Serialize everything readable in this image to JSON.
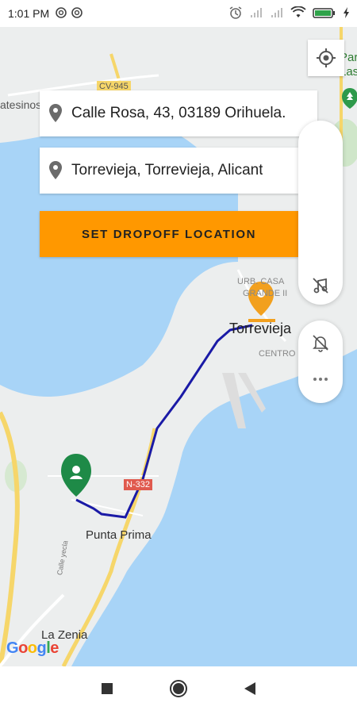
{
  "status_bar": {
    "time": "1:01 PM"
  },
  "search": {
    "pickup_text": "Calle Rosa, 43, 03189 Orihuela.",
    "destination_text": "Torrevieja, Torrevieja, Alicant"
  },
  "actions": {
    "set_dropoff_label": "SET DROPOFF LOCATION"
  },
  "map": {
    "labels": {
      "road_cv945": "CV-945",
      "atesinos": "atesinos",
      "urb_casa_1": "URB. CASA",
      "urb_casa_2": "GRANDE II",
      "torrevieja": "Torrevieja",
      "centro": "CENTRO",
      "road_n332": "N-332",
      "punta_prima": "Punta Prima",
      "calle_yecla": "Calle yecla",
      "la_zenia": "La Zenia",
      "park_1": "Par",
      "park_2": "Las",
      "google": "Google"
    },
    "route_color": "#1a1aa6",
    "destination_marker_color": "#f2a01e",
    "origin_marker_color": "#1e8a47",
    "water_color": "#a8d4f7",
    "land_color": "#eeeeee"
  }
}
